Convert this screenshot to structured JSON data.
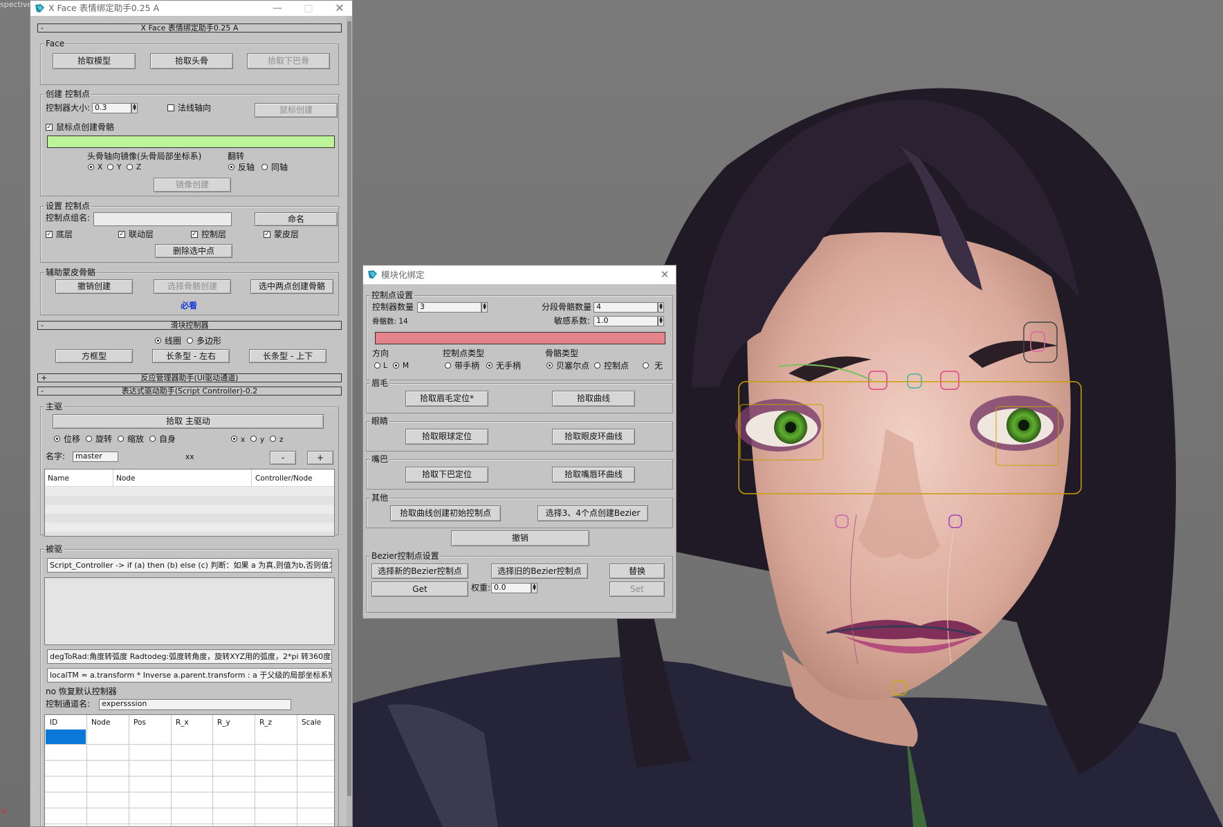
{
  "viewport": {
    "label": "spective",
    "axis_label": "x"
  },
  "xface": {
    "title": "X Face 表情绑定助手0.25 A",
    "rollout_main": "X Face 表情绑定助手0.25 A",
    "face_group": "Face",
    "pick_model": "拾取模型",
    "pick_head_bone": "拾取头骨",
    "pick_jaw_bone": "拾取下巴骨",
    "create_group": "创建 控制点",
    "ctrl_size_label": "控制器大小:",
    "ctrl_size_value": "0.3",
    "normal_axis_label": "法线轴向",
    "mouse_create": "鼠标创建",
    "mouse_point_bone_label": "鼠标点创建骨骼",
    "mirror_label": "头骨轴向镜像(头骨局部坐标系)",
    "mirror_x": "X",
    "mirror_y": "Y",
    "mirror_z": "Z",
    "flip_label": "翻转",
    "flip_reverse": "反轴",
    "flip_same": "同轴",
    "mirror_create": "镜像创建",
    "set_group": "设置 控制点",
    "group_name_label": "控制点组名:",
    "rename": "命名",
    "layer_base": "底层",
    "layer_link": "联动层",
    "layer_ctrl": "控制层",
    "layer_skin": "蒙皮层",
    "delete_center": "删除选中点",
    "aux_group": "辅助蒙皮骨骼",
    "undo_create": "撤销创建",
    "select_bone_create": "选择骨骼创建",
    "two_point_bone": "选中两点创建骨骼",
    "must_see": "必看",
    "rollout_slider": "滑块控制器",
    "slider_circle": "线圈",
    "slider_polygon": "多边形",
    "box_type": "方框型",
    "long_lr": "长条型 - 左右",
    "long_ud": "长条型 - 上下",
    "rollout_reaction": "反应管理器助手(UI驱动通道)",
    "rollout_expr": "表达式驱动助手(Script Controller)-0.2",
    "main_driver_group": "主驱",
    "pick_main_driver": "拾取 主驱动",
    "mode_move": "位移",
    "mode_rotate": "旋转",
    "mode_scale": "缩放",
    "mode_self": "自身",
    "axis_x": "x",
    "axis_y": "y",
    "axis_z": "z",
    "name_label": "名字:",
    "name_value": "master",
    "xx": "xx",
    "minus": "-",
    "plus": "+",
    "table1_headers": [
      "Name",
      "Node",
      "Controller/Node"
    ],
    "driven_group": "被驱",
    "script_hint1": "Script_Controller  ->  if (a) then (b) else (c) 判断：如果 a 为真,则值为b,否则值为",
    "script_hint2": "degToRad:角度转弧度 Radtodeg:弧度转角度，旋转XYZ用的弧度，2*pi 转360度",
    "script_hint3": "localTM = a.transform * Inverse a.parent.transform : a 于父级的局部坐标系矩阵",
    "restore_default": "no 恢复默认控制器",
    "channel_name_label": "控制通道名:",
    "channel_name_value": "expersssion",
    "table2_headers": [
      "ID",
      "Node",
      "Pos",
      "R_x",
      "R_y",
      "R_z",
      "Scale"
    ]
  },
  "modular": {
    "title": "模块化绑定",
    "ctrl_group": "控制点设置",
    "ctrl_count_label": "控制器数量",
    "ctrl_count_value": "3",
    "seg_bone_label": "分段骨骼数量",
    "seg_bone_value": "4",
    "bone_count_label": "骨骼数: 14",
    "sensitivity_label": "敏感系数:",
    "sensitivity_value": "1.0",
    "dir_label": "方向",
    "dir_l": "L",
    "dir_m": "M",
    "ctrl_type_label": "控制点类型",
    "with_handle": "带手柄",
    "no_handle": "无手柄",
    "bone_type_label": "骨骼类型",
    "bezier_point": "贝塞尔点",
    "ctrl_point": "控制点",
    "none": "无",
    "eyebrow_group": "眉毛",
    "pick_brow": "拾取眉毛定位*",
    "pick_curve": "拾取曲线",
    "eye_group": "眼睛",
    "pick_eyeball": "拾取眼球定位",
    "pick_eyelid": "拾取眼皮环曲线",
    "mouth_group": "嘴巴",
    "pick_jaw": "拾取下巴定位",
    "pick_lip": "拾取嘴唇环曲线",
    "other_group": "其他",
    "curve_init": "拾取曲线创建初始控制点",
    "select_bezier": "选择3、4个点创建Bezier",
    "undo": "撤销",
    "bezier_group": "Bezier控制点设置",
    "select_new_bezier": "选择新的Bezier控制点",
    "select_old_bezier": "选择旧的Bezier控制点",
    "replace": "替换",
    "get": "Get",
    "weight_label": "权重:",
    "weight_value": "0.0",
    "set": "Set"
  },
  "colors": {
    "green_bar": "#bdf49a",
    "pink_bar": "#e4838c",
    "link_blue": "#1a3cd9"
  }
}
